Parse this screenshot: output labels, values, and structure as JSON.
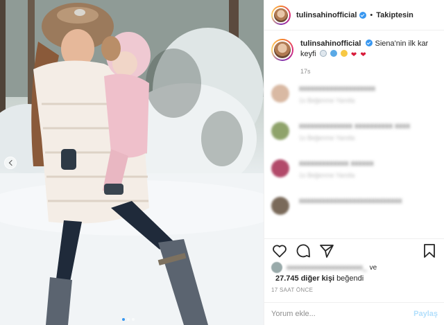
{
  "post": {
    "image_alt": "Woman in white fur coat holding a baby in pink snowsuit in snowy forest",
    "carousel_dots": 3,
    "active_dot": 1
  },
  "header": {
    "username": "tulinsahinofficial",
    "separator": "•",
    "follow_label": "Takiptesin"
  },
  "caption": {
    "username": "tulinsahinofficial",
    "text": "Siena'nin ilk kar keyfi",
    "emoji": [
      "snowman-icon",
      "snowflake-icon",
      "smiling-face-icon",
      "heart-icon",
      "heart-icon"
    ],
    "time": "17s"
  },
  "comments": [
    {
      "user": "xxxxxxxxxxxxxxxxxxxx",
      "text": "",
      "meta": "1s  Beğenme  Yanıtla",
      "avatar_color": "#d9b9a3"
    },
    {
      "user": "xxxxxxxxxxxxxx",
      "text": "xxxxxxxxxx xxxx",
      "meta": "1s  Beğenme  Yanıtla",
      "avatar_color": "#8fa36b"
    },
    {
      "user": "xxxxxxxxxxxxx",
      "text": "xxxxxx",
      "meta": "1s  Beğenme  Yanıtla",
      "avatar_color": "#b24a6a"
    },
    {
      "user": "xxxxxxxxxxxxxxxxxxxxxxxxxxx",
      "text": "",
      "meta": "",
      "avatar_color": "#7a6a5a"
    }
  ],
  "actions": {
    "like": "heart-icon",
    "comment": "comment-icon",
    "share": "share-icon",
    "save": "bookmark-icon"
  },
  "likes": {
    "liker": "xxxxxxxxxxxxxxxxxxxxxx_",
    "and": "ve",
    "count_text": "27.745 diğer kişi",
    "suffix": "beğendi"
  },
  "timestamp": "17 SAAT ÖNCE",
  "comment_input": {
    "placeholder": "Yorum ekle...",
    "post_label": "Paylaş"
  },
  "colors": {
    "accent": "#3897f0",
    "post_button_disabled": "#b2dffc"
  }
}
